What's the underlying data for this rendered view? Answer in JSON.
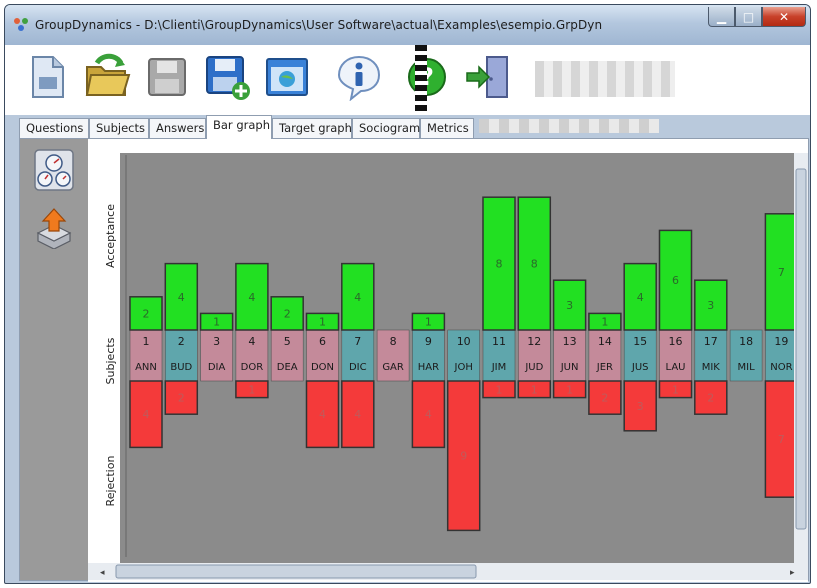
{
  "window": {
    "title": "GroupDynamics - D:\\Clienti\\GroupDynamics\\User Software\\actual\\Examples\\esempio.GrpDyn",
    "minimize_icon": "minimize-icon",
    "maximize_icon": "maximize-icon",
    "close_icon": "close-icon"
  },
  "toolbar": {
    "buttons": [
      {
        "name": "new-document-icon"
      },
      {
        "name": "open-folder-icon"
      },
      {
        "name": "save-disk-icon"
      },
      {
        "name": "save-as-disk-icon"
      },
      {
        "name": "web-browser-icon"
      },
      {
        "name": "info-icon"
      },
      {
        "name": "help-icon"
      },
      {
        "name": "exit-door-icon"
      }
    ]
  },
  "tabs": [
    {
      "label": "Questions"
    },
    {
      "label": "Subjects"
    },
    {
      "label": "Answers"
    },
    {
      "label": "Bar graph",
      "active": true
    },
    {
      "label": "Target graph"
    },
    {
      "label": "Sociogram"
    },
    {
      "label": "Metrics"
    }
  ],
  "sidebar": {
    "buttons": [
      {
        "name": "gauges-icon"
      },
      {
        "name": "export-tray-icon"
      }
    ]
  },
  "chart_data": {
    "type": "bar",
    "axis_labels": {
      "top": "Acceptance",
      "middle": "Subjects",
      "bottom": "Rejection"
    },
    "subjects": [
      {
        "num": "1",
        "code": "ANN",
        "acceptance": 2,
        "rejection": 4
      },
      {
        "num": "2",
        "code": "BUD",
        "acceptance": 4,
        "rejection": 2
      },
      {
        "num": "3",
        "code": "DIA",
        "acceptance": 1,
        "rejection": 0
      },
      {
        "num": "4",
        "code": "DOR",
        "acceptance": 4,
        "rejection": 1
      },
      {
        "num": "5",
        "code": "DEA",
        "acceptance": 2,
        "rejection": 0
      },
      {
        "num": "6",
        "code": "DON",
        "acceptance": 1,
        "rejection": 4
      },
      {
        "num": "7",
        "code": "DIC",
        "acceptance": 4,
        "rejection": 4
      },
      {
        "num": "8",
        "code": "GAR",
        "acceptance": 0,
        "rejection": 0
      },
      {
        "num": "9",
        "code": "HAR",
        "acceptance": 1,
        "rejection": 4
      },
      {
        "num": "10",
        "code": "JOH",
        "acceptance": 0,
        "rejection": 9
      },
      {
        "num": "11",
        "code": "JIM",
        "acceptance": 8,
        "rejection": 1
      },
      {
        "num": "12",
        "code": "JUD",
        "acceptance": 8,
        "rejection": 1
      },
      {
        "num": "13",
        "code": "JUN",
        "acceptance": 3,
        "rejection": 1
      },
      {
        "num": "14",
        "code": "JER",
        "acceptance": 1,
        "rejection": 2
      },
      {
        "num": "15",
        "code": "JUS",
        "acceptance": 4,
        "rejection": 3
      },
      {
        "num": "16",
        "code": "LAU",
        "acceptance": 6,
        "rejection": 1
      },
      {
        "num": "17",
        "code": "MIK",
        "acceptance": 3,
        "rejection": 2
      },
      {
        "num": "18",
        "code": "MIL",
        "acceptance": 0,
        "rejection": 0
      },
      {
        "num": "19",
        "code": "NOR",
        "acceptance": 7,
        "rejection": 7
      }
    ],
    "colors": {
      "acceptance": "#22e022",
      "rejection": "#f43a3a",
      "subject_pink": "#c48a9a",
      "subject_teal": "#5fa6ac",
      "background": "#8b8b8b"
    }
  }
}
